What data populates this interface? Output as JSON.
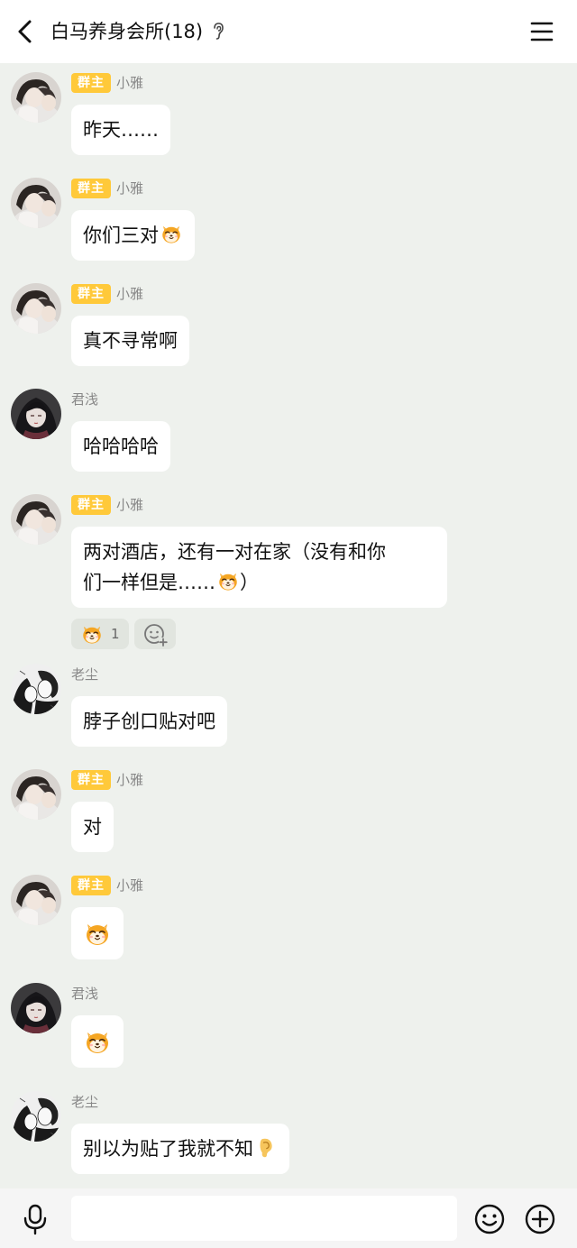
{
  "header": {
    "title": "白马养身会所(18)",
    "back_icon": "chevron-left-icon",
    "ear_icon": "ear-icon",
    "menu_icon": "hamburger-menu-icon"
  },
  "owner_badge": "群主",
  "messages": [
    {
      "sender": "小雅",
      "owner": true,
      "text": "昨天……",
      "emoji": false
    },
    {
      "sender": "小雅",
      "owner": true,
      "text": "你们三对",
      "emoji": true
    },
    {
      "sender": "小雅",
      "owner": true,
      "text": "真不寻常啊",
      "emoji": false
    },
    {
      "sender": "君浅",
      "owner": false,
      "text": "哈哈哈哈",
      "emoji": false
    },
    {
      "sender": "小雅",
      "owner": true,
      "text_line1": "两对酒店，还有一对在家（没有和你",
      "text_line2": "们一样但是……",
      "text_line2_end": "）",
      "emoji": true
    },
    {
      "sender": "老尘",
      "owner": false,
      "text": "脖子创口贴对吧",
      "emoji": false
    },
    {
      "sender": "小雅",
      "owner": true,
      "text": "对",
      "emoji": false
    },
    {
      "sender": "小雅",
      "owner": true,
      "sticker": "shiba-dog-emoji"
    },
    {
      "sender": "君浅",
      "owner": false,
      "sticker": "shiba-dog-emoji"
    },
    {
      "sender": "老尘",
      "owner": false,
      "text": "别以为贴了我就不知",
      "emoji": "ear-emoji"
    }
  ],
  "reaction": {
    "emoji": "shiba-dog-emoji",
    "count": "1",
    "add_icon": "add-reaction-icon"
  },
  "bottombar": {
    "mic_icon": "microphone-icon",
    "input_value": "",
    "emoji_icon": "smiley-icon",
    "plus_icon": "plus-circle-icon"
  },
  "colors": {
    "background": "#eef1ed",
    "badge": "#ffc93a",
    "bubble": "#ffffff"
  }
}
